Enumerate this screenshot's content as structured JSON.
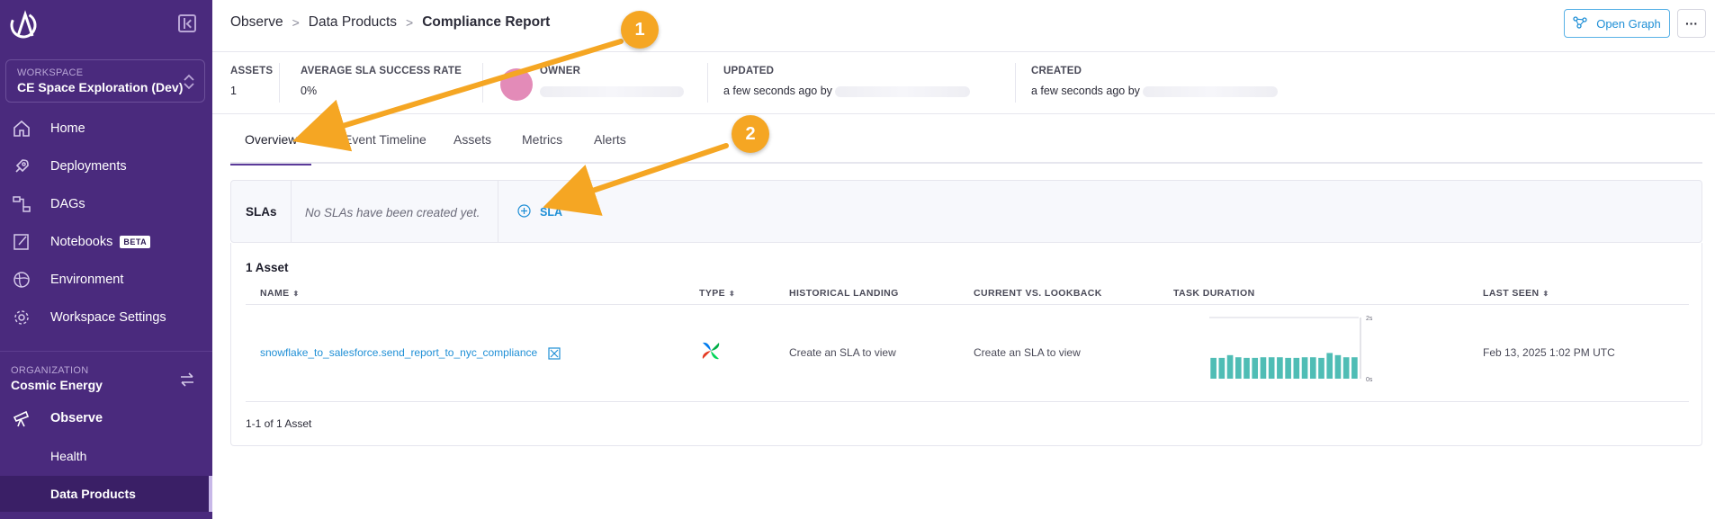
{
  "sidebar": {
    "workspace_caption": "WORKSPACE",
    "workspace_name": "CE Space Exploration (Dev)",
    "nav": [
      {
        "label": "Home",
        "icon": "home-icon"
      },
      {
        "label": "Deployments",
        "icon": "rocket-icon"
      },
      {
        "label": "DAGs",
        "icon": "dag-icon"
      },
      {
        "label": "Notebooks",
        "icon": "notebook-icon",
        "badge": "BETA"
      },
      {
        "label": "Environment",
        "icon": "globe-icon"
      },
      {
        "label": "Workspace Settings",
        "icon": "gear-icon"
      }
    ],
    "org_caption": "ORGANIZATION",
    "org_name": "Cosmic Energy",
    "observe_label": "Observe",
    "sub_items": [
      {
        "label": "Health"
      },
      {
        "label": "Data Products",
        "active": true
      }
    ]
  },
  "header": {
    "breadcrumb": [
      "Observe",
      "Data Products",
      "Compliance Report"
    ],
    "open_graph_label": "Open Graph",
    "more_label": "···"
  },
  "meta": {
    "assets_label": "ASSETS",
    "assets_value": "1",
    "sla_label": "AVERAGE SLA SUCCESS RATE",
    "sla_value": "0%",
    "owner_label": "OWNER",
    "updated_label": "UPDATED",
    "updated_value": "a few seconds ago by",
    "created_label": "CREATED",
    "created_value": "a few seconds ago by"
  },
  "tabs": [
    "Overview",
    "Event Timeline",
    "Assets",
    "Metrics",
    "Alerts"
  ],
  "sla": {
    "title": "SLAs",
    "empty_text": "No SLAs have been created yet.",
    "add_label": "SLA"
  },
  "assets": {
    "title": "1 Asset",
    "columns": [
      "NAME",
      "TYPE",
      "HISTORICAL LANDING",
      "CURRENT VS. LOOKBACK",
      "TASK DURATION",
      "LAST SEEN"
    ],
    "rows": [
      {
        "name": "snowflake_to_salesforce.send_report_to_nyc_compliance",
        "type_icon": "airflow-icon",
        "historical_landing": "Create an SLA to view",
        "current_vs_lookback": "Create an SLA to view",
        "last_seen": "Feb 13, 2025 1:02 PM UTC"
      }
    ],
    "pagination": "1-1 of 1 Asset"
  },
  "chart_data": {
    "type": "bar",
    "title": "",
    "xlabel": "",
    "ylabel": "",
    "ytick_labels": [
      "2s",
      "0s"
    ],
    "ylim": [
      0,
      2
    ],
    "values": [
      0.68,
      0.68,
      0.77,
      0.7,
      0.68,
      0.68,
      0.7,
      0.7,
      0.7,
      0.68,
      0.68,
      0.7,
      0.7,
      0.68,
      0.84,
      0.77,
      0.7,
      0.7
    ],
    "color": "#4fbdb5"
  },
  "annotations": [
    {
      "number": "1",
      "target": "Overview tab"
    },
    {
      "number": "2",
      "target": "SLA button"
    }
  ],
  "colors": {
    "sidebar": "#4a2a7d",
    "accent": "#1f8fd6",
    "badge": "#f5a623"
  }
}
